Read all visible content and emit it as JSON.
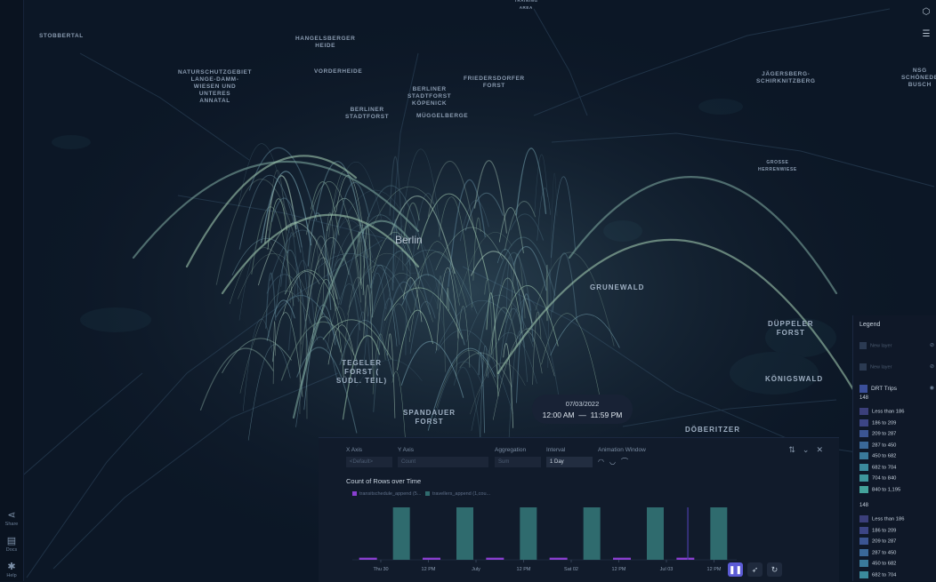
{
  "map": {
    "city": "Berlin",
    "labels": [
      {
        "id": "stobbertal",
        "text": "STOBBERTAL"
      },
      {
        "id": "hangelsberger",
        "text": "HANGELSBERGER\nHEIDE"
      },
      {
        "id": "naturschutz",
        "text": "NATURSCHUTZGEBIET\nLANGE-DAMM-\nWIESEN UND\nUNTERES\nANNATAL"
      },
      {
        "id": "vorderheide",
        "text": "VORDERHEIDE"
      },
      {
        "id": "berliner-koepenick",
        "text": "BERLINER\nSTADTFORST\nKÖPENICK"
      },
      {
        "id": "friedersdorfer",
        "text": "FRIEDERSDORFER\nFORST"
      },
      {
        "id": "berliner-stadtforst",
        "text": "BERLINER\nSTADTFORST"
      },
      {
        "id": "mueggelberge",
        "text": "MÜGGELBERGE"
      },
      {
        "id": "jaegersberg",
        "text": "JÄGERSBERG-\nSCHIRKNITZBERG"
      },
      {
        "id": "nsg",
        "text": "NSG\nSCHÖNEDE\nBUSCH"
      },
      {
        "id": "grosse-heide",
        "text": "GROSSE\nHERRENWIESE"
      },
      {
        "id": "training",
        "text": "TRAINING\nAREA"
      },
      {
        "id": "grunewald",
        "text": "GRUNEWALD"
      },
      {
        "id": "dueppeler",
        "text": "DÜPPELER\nFORST"
      },
      {
        "id": "koenigswald",
        "text": "KÖNIGSWALD"
      },
      {
        "id": "tegeler",
        "text": "TEGELER\nFORST (\nSÜDL. TEIL)"
      },
      {
        "id": "spandauer",
        "text": "SPANDAUER\nFORST"
      },
      {
        "id": "doeberitzer",
        "text": "DÖBERITZER"
      }
    ]
  },
  "left_rail": {
    "share_label": "Share",
    "docs_label": "Docs",
    "help_label": "Help"
  },
  "top_right": {
    "icons": [
      "cube-icon",
      "layers-panel-icon"
    ]
  },
  "time_pill": {
    "date": "07/03/2022",
    "start": "12:00 AM",
    "separator": "—",
    "end": "11:59 PM"
  },
  "panel": {
    "x_axis_label": "X Axis",
    "x_axis_value": "<Default>",
    "y_axis_label": "Y Axis",
    "y_axis_value": "Count",
    "aggregation_label": "Aggregation",
    "aggregation_value": "Sum",
    "interval_label": "Interval",
    "interval_value": "1 Day",
    "animation_window_label": "Animation Window",
    "chart_title": "Count of Rows over Time",
    "play_buttons": [
      "pause-icon",
      "rocket-icon",
      "refresh-icon"
    ]
  },
  "chart_data": {
    "type": "bar",
    "title": "Count of Rows over Time",
    "x_tick_labels": [
      "Thu 30",
      "12 PM",
      "July",
      "12 PM",
      "Sat 02",
      "12 PM",
      "Jul 03",
      "12 PM"
    ],
    "series": [
      {
        "name": "transitschedule_append (5...",
        "color": "#8a3fd1",
        "values": [
          0.04,
          0.04,
          0.04,
          0.04,
          0.04,
          0.04
        ]
      },
      {
        "name": "travellers_append (1,cou...",
        "color": "#2f6b6e",
        "values": [
          1,
          1,
          1,
          1,
          1,
          1
        ]
      }
    ],
    "current_time_marker": "Jul 03",
    "grid": false,
    "legend_position": "top-left"
  },
  "legend": {
    "title": "Legend",
    "hidden_layers": [
      "New layer",
      "New layer"
    ],
    "layer_name": "DRT Trips",
    "groups": [
      {
        "count": "148",
        "items": [
          {
            "label": "Less than 186",
            "color": "#3b3f7a"
          },
          {
            "label": "186 to 209",
            "color": "#3c4585"
          },
          {
            "label": "209 to 287",
            "color": "#3b5592"
          },
          {
            "label": "287 to 450",
            "color": "#3a6898"
          },
          {
            "label": "450 to 682",
            "color": "#3a7a9b"
          },
          {
            "label": "682 to 704",
            "color": "#3b8a9c"
          },
          {
            "label": "704 to 840",
            "color": "#3e969c"
          },
          {
            "label": "840 to 1,195",
            "color": "#44a39b"
          }
        ]
      },
      {
        "count": "148",
        "items": [
          {
            "label": "Less than 186",
            "color": "#3b3f7a"
          },
          {
            "label": "186 to 209",
            "color": "#3c4585"
          },
          {
            "label": "209 to 287",
            "color": "#3b5592"
          },
          {
            "label": "287 to 450",
            "color": "#3a6898"
          },
          {
            "label": "450 to 682",
            "color": "#3a7a9b"
          },
          {
            "label": "682 to 704",
            "color": "#3b8a9c"
          }
        ]
      }
    ]
  }
}
